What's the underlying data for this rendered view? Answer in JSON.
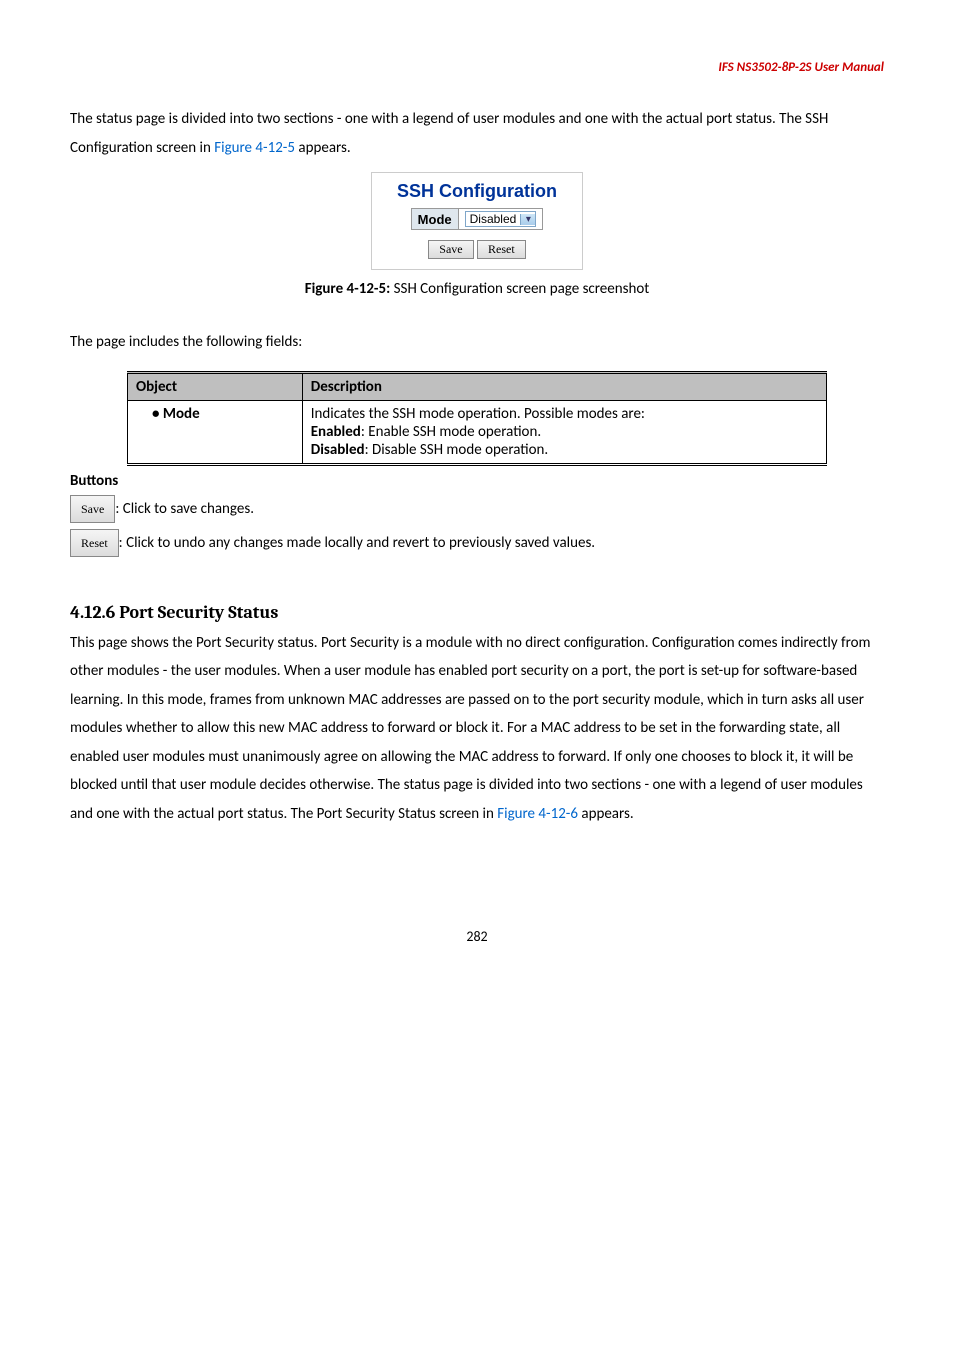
{
  "header": {
    "title": "IFS NS3502-8P-2S  User  Manual"
  },
  "intro": {
    "p1a": "The status page is divided into two sections - one with a legend of user modules and one with the actual port status. The SSH Configuration screen in ",
    "p1link": "Figure 4-12-5",
    "p1b": " appears."
  },
  "sshBox": {
    "title": "SSH Configuration",
    "modeLabel": "Mode",
    "modeValue": "Disabled",
    "saveBtn": "Save",
    "resetBtn": "Reset"
  },
  "caption": {
    "figBold": "Figure 4-12-5:",
    "figRest": " SSH Configuration screen page screenshot"
  },
  "fieldsIntro": "The page includes the following fields:",
  "table": {
    "hObject": "Object",
    "hDesc": "Description",
    "objMode": "• Mode",
    "desc1": "Indicates the SSH mode operation. Possible modes are:",
    "desc2a": "Enabled",
    "desc2b": ": Enable SSH mode operation.",
    "desc3a": "Disabled",
    "desc3b": ": Disable SSH mode operation."
  },
  "buttons": {
    "heading": "Buttons",
    "saveBtn": "Save",
    "saveText": ": Click to save changes.",
    "resetBtn": "Reset",
    "resetText": ": Click to undo any changes made locally and revert to previously saved values."
  },
  "section": {
    "heading": "4.12.6 Port Security Status",
    "bodyA": "This page shows the Port Security status. Port Security is a module with no direct configuration. Configuration comes indirectly from other modules - the user modules. When a user module has enabled port security on a port, the port is set-up for software-based learning. In this mode, frames from unknown MAC addresses are passed on to the port security module, which in turn asks all user modules whether to allow this new MAC address to forward or block it. For a MAC address to be set in the forwarding state, all enabled user modules must unanimously agree on allowing the MAC address to forward. If only one chooses to block it, it will be blocked until that user module decides otherwise. The status page is divided into two sections - one with a legend of user modules and one with the actual port status. The Port Security Status screen in ",
    "bodyLink": "Figure 4-12-6",
    "bodyB": " appears."
  },
  "pageNumber": "282"
}
